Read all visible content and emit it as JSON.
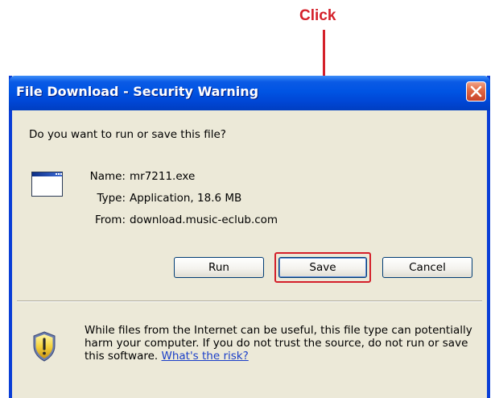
{
  "annotation": {
    "label": "Click",
    "color": "#d4202a"
  },
  "dialog": {
    "title": "File Download - Security Warning",
    "question": "Do you want to run or save this file?",
    "file_icon": "application-window-icon",
    "info": {
      "name_label": "Name:",
      "name_value": "mr7211.exe",
      "type_label": "Type:",
      "type_value": "Application, 18.6 MB",
      "from_label": "From:",
      "from_value": "download.music-eclub.com"
    },
    "buttons": {
      "run": "Run",
      "save": "Save",
      "cancel": "Cancel"
    },
    "warning": {
      "icon": "shield-warning-icon",
      "text": "While files from the Internet can be useful, this file type can potentially harm your computer. If you do not trust the source, do not run or save this software.",
      "link": "What's the risk?"
    }
  },
  "colors": {
    "titlebar": "#0054e3",
    "window_bg": "#ece9d8",
    "close_button": "#e26b46",
    "link": "#1a3ec8"
  }
}
